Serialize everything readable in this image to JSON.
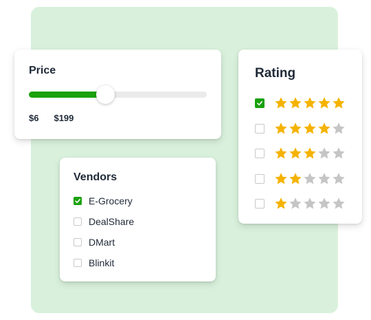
{
  "colors": {
    "background_panel": "#d9f1dc",
    "accent_green": "#1aa20c",
    "star_filled": "#f5b300",
    "star_empty": "#c5c5c5"
  },
  "price": {
    "title": "Price",
    "min_label": "$6",
    "max_label": "$199",
    "slider_fill_fraction": 0.43
  },
  "vendors": {
    "title": "Vendors",
    "items": [
      {
        "label": "E-Grocery",
        "checked": true
      },
      {
        "label": "DealShare",
        "checked": false
      },
      {
        "label": "DMart",
        "checked": false
      },
      {
        "label": "Blinkit",
        "checked": false
      }
    ]
  },
  "rating": {
    "title": "Rating",
    "options": [
      {
        "stars": 5,
        "checked": true
      },
      {
        "stars": 4,
        "checked": false
      },
      {
        "stars": 3,
        "checked": false
      },
      {
        "stars": 2,
        "checked": false
      },
      {
        "stars": 1,
        "checked": false
      }
    ],
    "max_stars": 5
  }
}
